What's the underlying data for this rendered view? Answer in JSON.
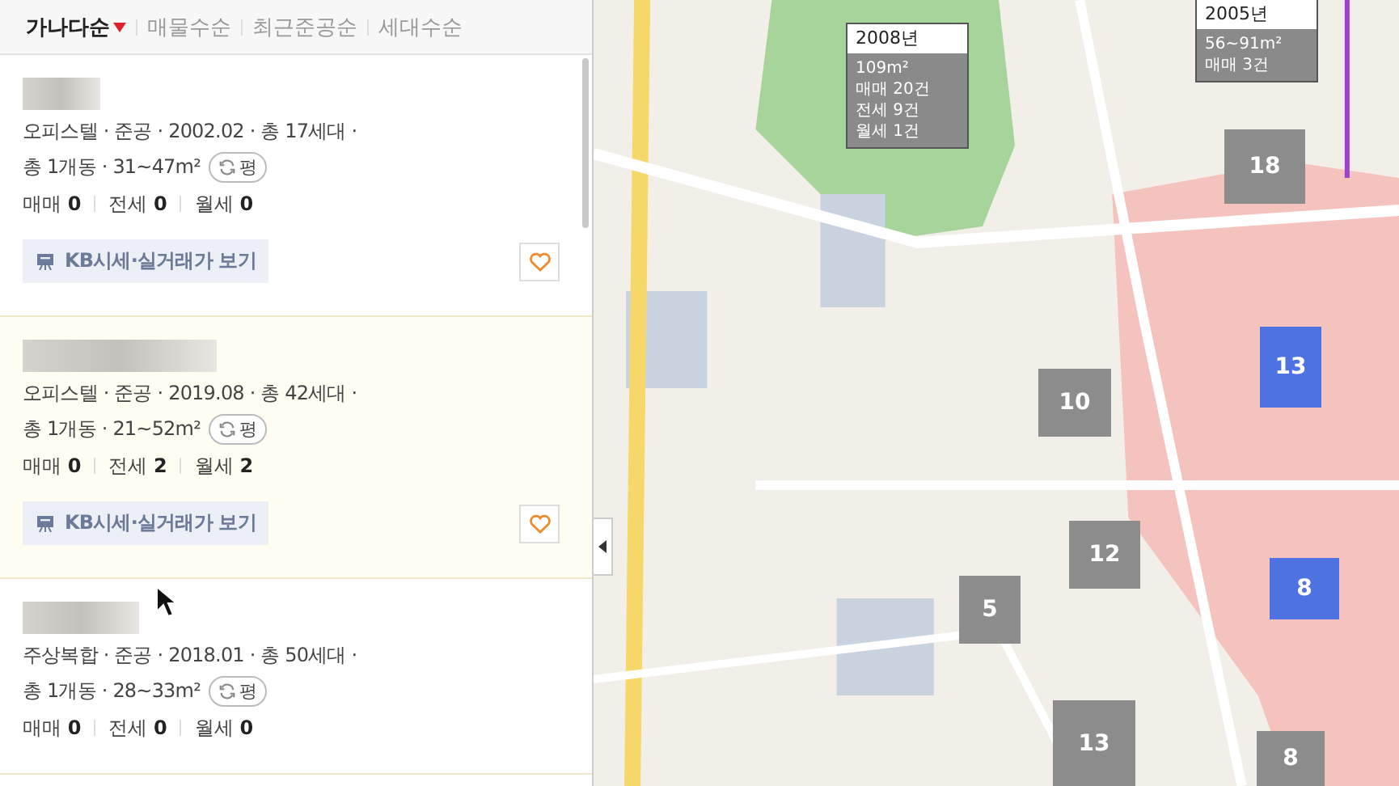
{
  "sort_tabs": [
    {
      "label": "가나다순",
      "selected": true
    },
    {
      "label": "매물수순",
      "selected": false
    },
    {
      "label": "최근준공순",
      "selected": false
    },
    {
      "label": "세대수순",
      "selected": false
    }
  ],
  "listings": [
    {
      "selected": false,
      "info": "오피스텔 · 준공 · 2002.02 · 총 17세대 ·",
      "info2": "총 1개동 · 31~47m²",
      "unit_toggle": "평",
      "counts": [
        {
          "label": "매매",
          "value": "0"
        },
        {
          "label": "전세",
          "value": "0"
        },
        {
          "label": "월세",
          "value": "0"
        }
      ],
      "kb_button": "KB시세·실거래가 보기"
    },
    {
      "selected": true,
      "info": "오피스텔 · 준공 · 2019.08 · 총 42세대 ·",
      "info2": "총 1개동 · 21~52m²",
      "unit_toggle": "평",
      "counts": [
        {
          "label": "매매",
          "value": "0"
        },
        {
          "label": "전세",
          "value": "2"
        },
        {
          "label": "월세",
          "value": "2"
        }
      ],
      "kb_button": "KB시세·실거래가 보기"
    },
    {
      "selected": false,
      "info": "주상복합 · 준공 · 2018.01 · 총 50세대 ·",
      "info2": "총 1개동 · 28~33m²",
      "unit_toggle": "평",
      "counts": [
        {
          "label": "매매",
          "value": "0"
        },
        {
          "label": "전세",
          "value": "0"
        },
        {
          "label": "월세",
          "value": "0"
        }
      ]
    }
  ],
  "map": {
    "kind": "picture",
    "clusters": [
      {
        "count": "18",
        "color": "#8c8c8c"
      },
      {
        "count": "10",
        "color": "#8c8c8c"
      },
      {
        "count": "13",
        "color": "#4f72e3"
      },
      {
        "count": "12",
        "color": "#8c8c8c"
      },
      {
        "count": "5",
        "color": "#8c8c8c"
      },
      {
        "count": "8",
        "color": "#4f72e3"
      },
      {
        "count": "13",
        "color": "#8c8c8c"
      },
      {
        "count": "8",
        "color": "#8c8c8c"
      }
    ],
    "tooltips": [
      {
        "year": "2008년",
        "lines": [
          "109m²",
          "매매 20건",
          "전세 9건",
          "월세 1건"
        ]
      },
      {
        "year": "2005년",
        "lines": [
          "56~91m²",
          "매매 3건"
        ]
      }
    ]
  }
}
